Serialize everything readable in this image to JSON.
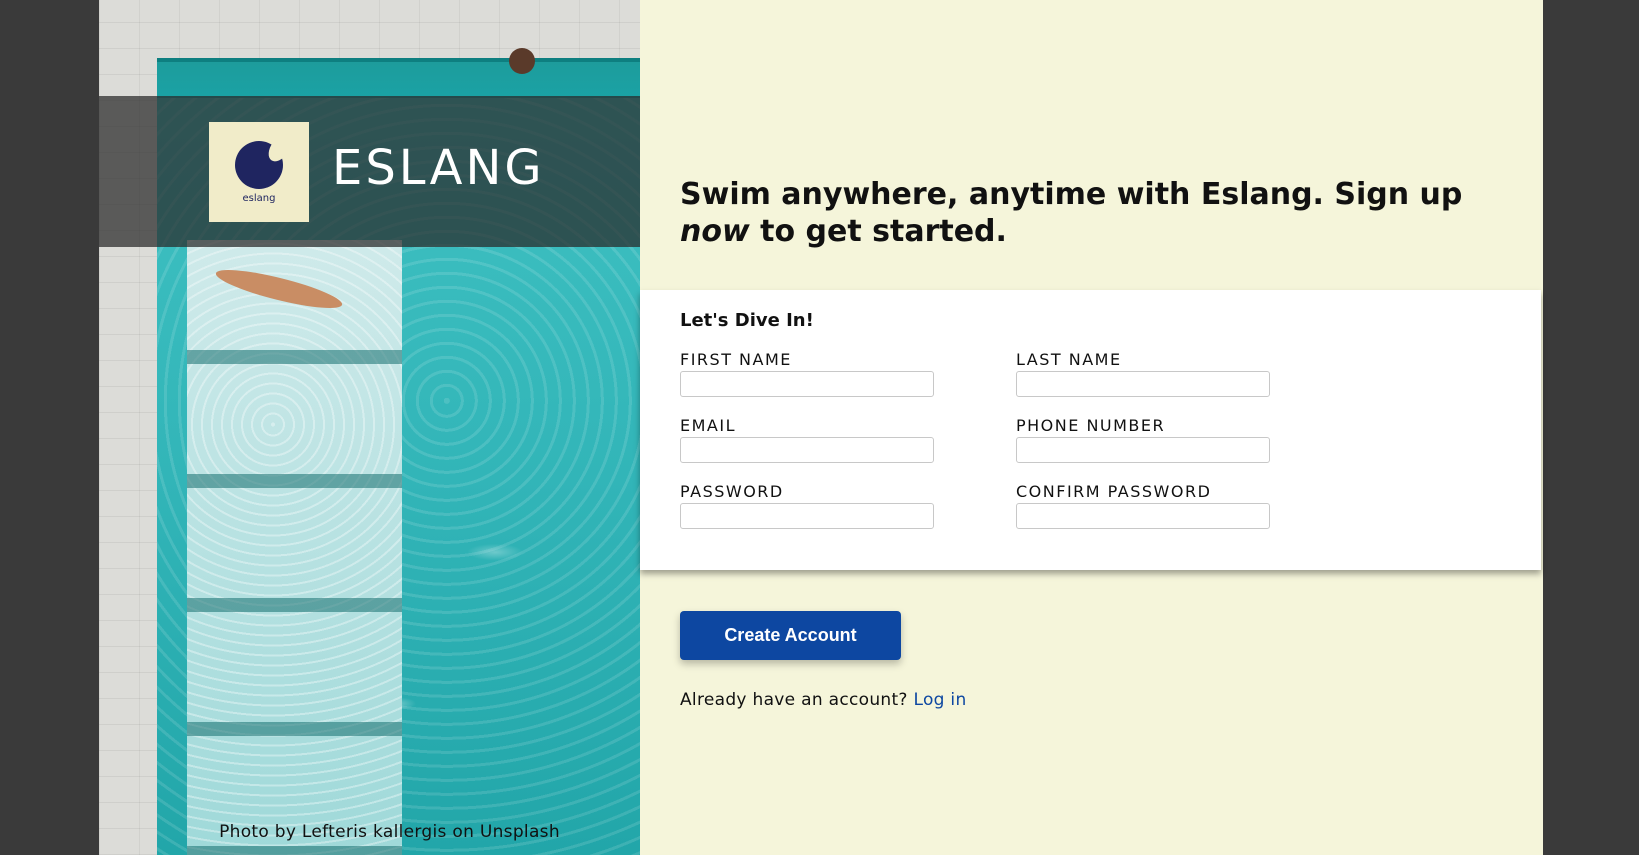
{
  "hero": {
    "brand_name": "ESLANG",
    "logo_text": "eslang",
    "photo_credit": "Photo by Lefteris kallergis on Unsplash"
  },
  "signup": {
    "headline_part1": "Swim anywhere, anytime with Eslang. Sign up ",
    "headline_emphasis": "now",
    "headline_part2": " to get started.",
    "card_title": "Let's Dive In!",
    "fields": {
      "first_name": "FIRST NAME",
      "last_name": "LAST NAME",
      "email": "EMAIL",
      "phone": "PHONE NUMBER",
      "password": "PASSWORD",
      "confirm_password": "CONFIRM PASSWORD"
    },
    "create_button": "Create Account",
    "login_prompt": "Already have an account? ",
    "login_link": "Log in"
  },
  "colors": {
    "page_background": "#3a3a3a",
    "panel_background": "#f5f5da",
    "accent_blue": "#0d47a1",
    "pool_teal": "#32b5b8"
  },
  "icons": {
    "logo": "eslang-rocket-logo"
  }
}
